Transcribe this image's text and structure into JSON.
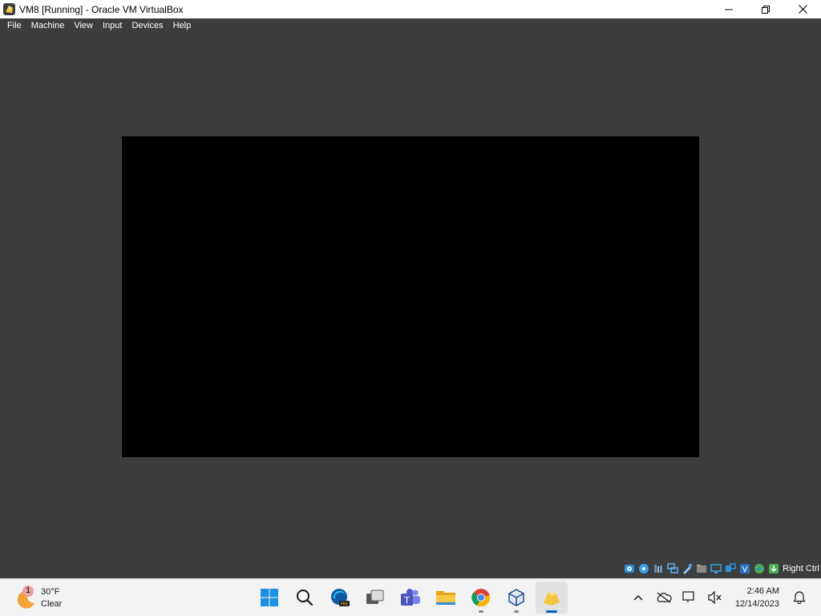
{
  "window": {
    "title": "VM8 [Running] - Oracle VM VirtualBox",
    "controls": [
      "minimize-icon",
      "maximize-icon",
      "close-icon"
    ]
  },
  "menu": {
    "items": [
      {
        "label": "File"
      },
      {
        "label": "Machine"
      },
      {
        "label": "View"
      },
      {
        "label": "Input"
      },
      {
        "label": "Devices"
      },
      {
        "label": "Help"
      }
    ]
  },
  "vm": {
    "screen_color": "#000000",
    "background_color": "#3c3d3f"
  },
  "statusbar": {
    "icons": [
      "hard-disk-icon",
      "optical-drive-icon",
      "audio-icon",
      "network-icon",
      "usb-icon",
      "shared-folders-icon",
      "display-icon",
      "video-capture-icon",
      "virtualization-icon",
      "mouse-integration-icon",
      "keyboard-icon"
    ],
    "host_key": "Right Ctrl"
  },
  "taskbar": {
    "weather": {
      "badge": "1",
      "temperature": "30°F",
      "condition": "Clear"
    },
    "apps": [
      "start-icon",
      "search-icon",
      "edge-preview-icon",
      "task-view-icon",
      "teams-icon",
      "file-explorer-icon",
      "chrome-icon",
      "virtualbox-icon",
      "virtualbox-vm-icon"
    ],
    "tray": {
      "icons": [
        "chevron-up-icon",
        "onedrive-icon",
        "network-icon",
        "volume-muted-icon"
      ],
      "time": "2:46 AM",
      "date": "12/14/2023",
      "notification_icon": "bell-icon"
    }
  },
  "colors": {
    "accent": "#0067c0",
    "titlebar": "#ffffff",
    "chrome_bg": "#3c3d3f",
    "taskbar_bg": "#f3f3f3"
  }
}
